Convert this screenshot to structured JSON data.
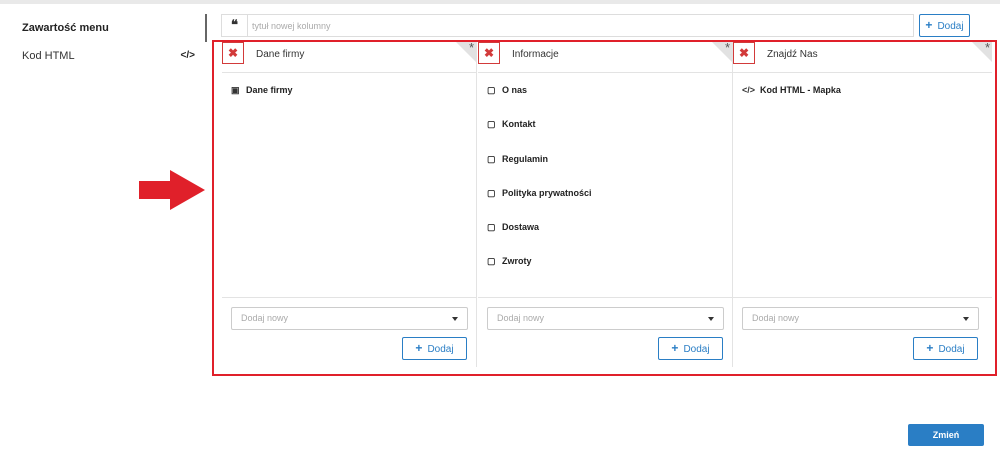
{
  "sidebar": {
    "items": [
      {
        "label": "Zawartość menu",
        "icon": ""
      },
      {
        "label": "Kod HTML",
        "icon": "</>"
      }
    ]
  },
  "new_column": {
    "quote_glyph": "❝",
    "placeholder": "tytuł nowej kolumny",
    "add_label": "Dodaj",
    "add_icon": "+"
  },
  "columns": [
    {
      "title": "Dane firmy",
      "delete_glyph": "✖",
      "corner_glyph": "*",
      "items": [
        {
          "label": "Dane firmy",
          "icon": "▣"
        }
      ],
      "select_placeholder": "Dodaj nowy",
      "add_label": "Dodaj",
      "add_icon": "+"
    },
    {
      "title": "Informacje",
      "delete_glyph": "✖",
      "corner_glyph": "*",
      "items": [
        {
          "label": "O nas",
          "icon": "▢"
        },
        {
          "label": "Kontakt",
          "icon": "▢"
        },
        {
          "label": "Regulamin",
          "icon": "▢"
        },
        {
          "label": "Polityka prywatności",
          "icon": "▢"
        },
        {
          "label": "Dostawa",
          "icon": "▢"
        },
        {
          "label": "Zwroty",
          "icon": "▢"
        }
      ],
      "select_placeholder": "Dodaj nowy",
      "add_label": "Dodaj",
      "add_icon": "+"
    },
    {
      "title": "Znajdź Nas",
      "delete_glyph": "✖",
      "corner_glyph": "*",
      "items": [
        {
          "label": "Kod HTML - Mapka",
          "icon": "</>"
        }
      ],
      "select_placeholder": "Dodaj nowy",
      "add_label": "Dodaj",
      "add_icon": "+"
    }
  ],
  "submit": {
    "label": "Zmień"
  },
  "colors": {
    "accent_blue": "#2a7ec5",
    "highlight_red": "#e0202a",
    "delete_red": "#d23a3a"
  }
}
